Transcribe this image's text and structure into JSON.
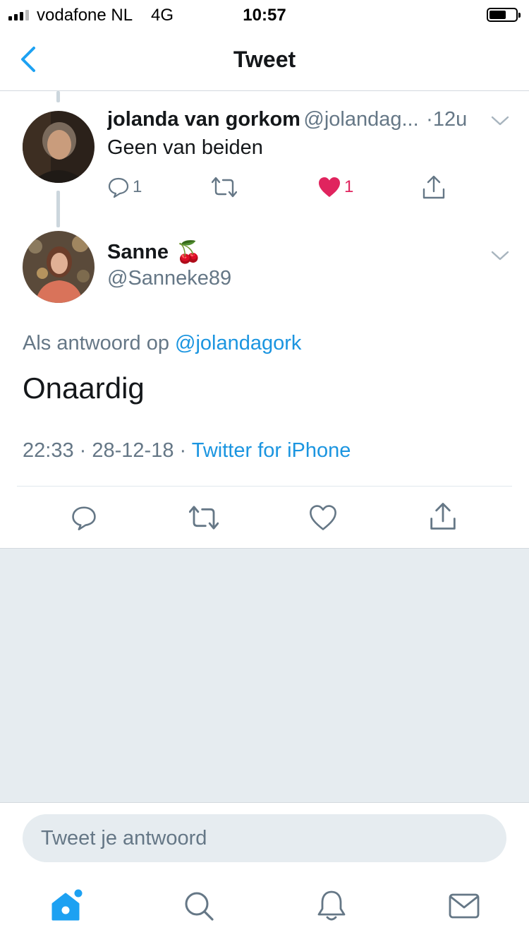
{
  "status_bar": {
    "carrier": "vodafone NL",
    "network": "4G",
    "time": "10:57"
  },
  "nav": {
    "title": "Tweet",
    "back_icon": "chevron-left-icon"
  },
  "parent_tweet": {
    "display_name": "jolanda van gorkom",
    "handle": "@jolandag...",
    "time_sep": "·",
    "time": "12u",
    "text": "Geen van beiden",
    "reply_count": "1",
    "like_count": "1",
    "liked": true
  },
  "main_tweet": {
    "display_name": "Sanne",
    "name_emoji": "🍒",
    "handle": "@Sanneke89",
    "reply_prefix": "Als antwoord op",
    "reply_to": "@jolandagork",
    "text": "Onaardig",
    "time": "22:33",
    "date": "28-12-18",
    "sep": "·",
    "source": "Twitter for iPhone"
  },
  "reply_box": {
    "placeholder": "Tweet je antwoord"
  },
  "tab_bar": [
    "home-icon",
    "search-icon",
    "bell-icon",
    "mail-icon"
  ],
  "colors": {
    "accent": "#1da1f2",
    "link": "#1b95e0",
    "like": "#e0245e",
    "muted": "#657786",
    "background_grey": "#e6ecf0"
  }
}
